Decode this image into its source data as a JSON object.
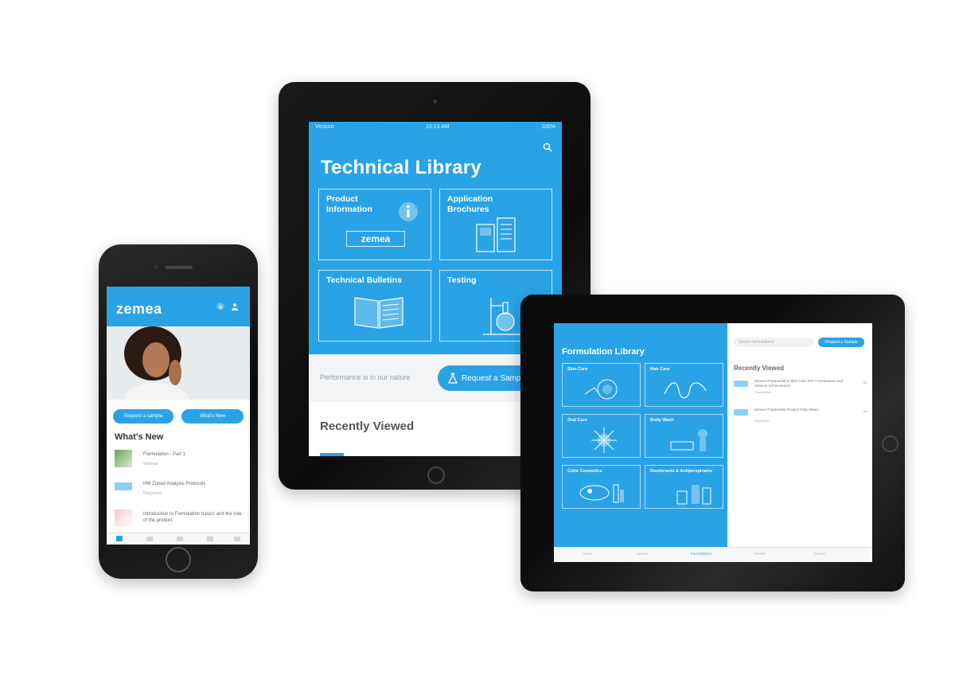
{
  "colors": {
    "accent": "#2aa3e6",
    "bezel": "#111111",
    "background": "#ffffff"
  },
  "ipad_portrait": {
    "status": {
      "carrier": "Verizon",
      "time": "10:13 AM",
      "battery": "100%"
    },
    "title": "Technical Library",
    "tiles": [
      {
        "label": "Product Information",
        "badge_logo": "zemea",
        "icon": "info-icon"
      },
      {
        "label": "Application Brochures",
        "icon": "brochure-icon"
      },
      {
        "label": "Technical Bulletins",
        "icon": "book-icon"
      },
      {
        "label": "Testing",
        "icon": "lab-flask-icon"
      }
    ],
    "bar_text": "Performance is in our nature",
    "request_button": "Request a Sample",
    "recently_viewed": "Recently Viewed"
  },
  "iphone": {
    "logo": "zemea",
    "buttons": [
      "Request a sample",
      "What's New"
    ],
    "whats_new_title": "What's New",
    "items": [
      {
        "title": "Formulation - Part 1",
        "sub": "Webinar"
      },
      {
        "title": "HM Zoned Analysis Protocols",
        "sub": "Document"
      },
      {
        "title": "Introduction to Formulation basics and the role of the product",
        "sub": "Webinar"
      }
    ]
  },
  "ipad_landscape": {
    "title": "Formulation Library",
    "tiles": [
      "Skin Care",
      "Hair Care",
      "Oral Care",
      "Body Wash",
      "Color Cosmetics",
      "Deodorants & Antiperspirants"
    ],
    "search_placeholder": "Search formulations",
    "request_button": "Request a Sample",
    "recently_viewed": "Recently Viewed",
    "recent_items": [
      {
        "title": "Zemea Propanediol in Skin Care SPF Formulations and Sensory Enhancement",
        "sub": "Formulation",
        "date": "3/4"
      },
      {
        "title": "Zemea Propanediol Product Data Sheet",
        "sub": "Document",
        "date": "3/4"
      }
    ],
    "tabs": [
      "Home",
      "Library",
      "Formulations",
      "Events",
      "Contact"
    ]
  }
}
